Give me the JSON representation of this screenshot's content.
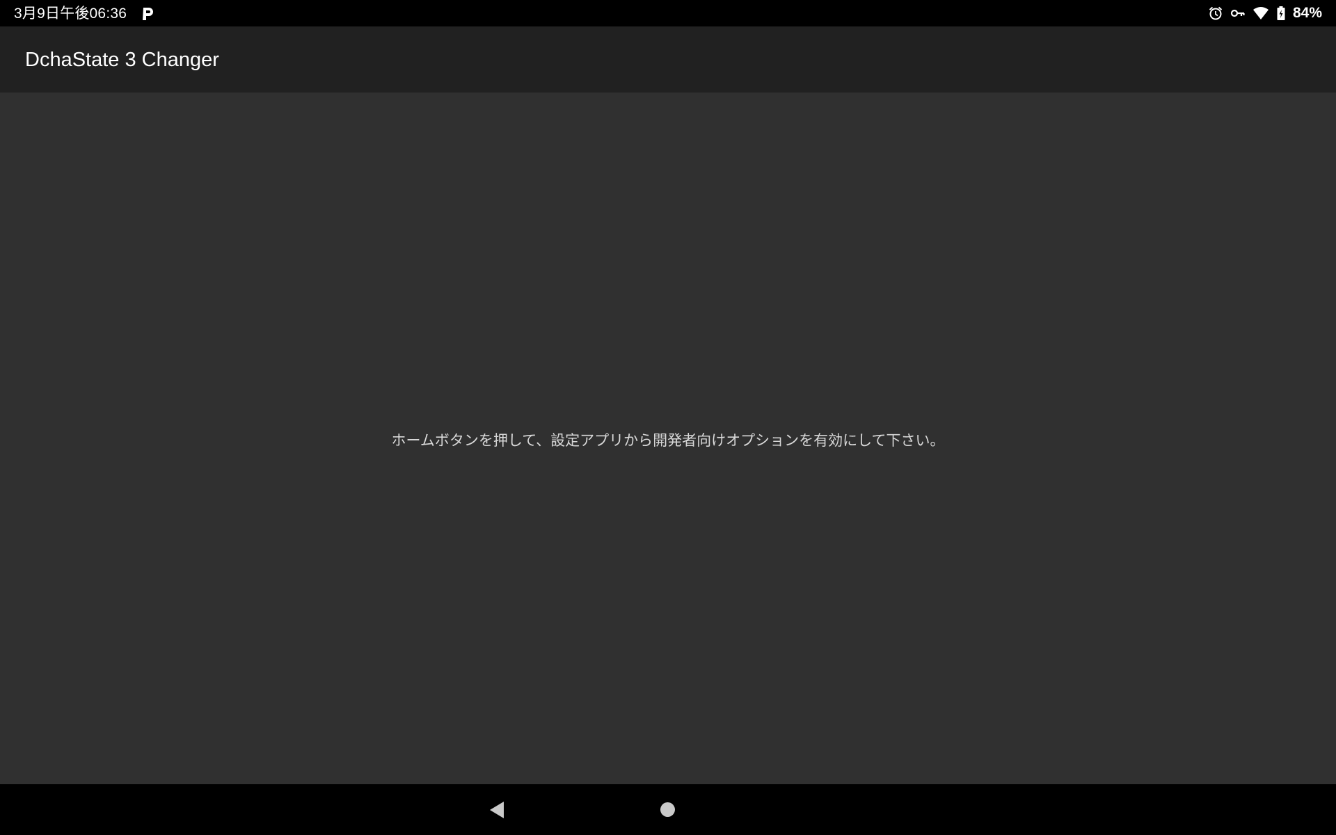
{
  "status_bar": {
    "time": "3月9日午後06:36",
    "notification_icons": [
      "p-app-icon"
    ],
    "system_icons": [
      "alarm-icon",
      "vpn-key-icon",
      "wifi-icon",
      "battery-charging-icon"
    ],
    "battery_percent": "84%"
  },
  "app_bar": {
    "title": "DchaState 3 Changer"
  },
  "main": {
    "message": "ホームボタンを押して、設定アプリから開発者向けオプションを有効にして下さい。"
  },
  "nav_bar": {
    "buttons": [
      "back-button",
      "home-button"
    ]
  },
  "colors": {
    "status_bar": "#000000",
    "app_bar": "#212121",
    "content_background": "#303030",
    "message_text": "#d8d8d8",
    "title_text": "#ffffff"
  }
}
